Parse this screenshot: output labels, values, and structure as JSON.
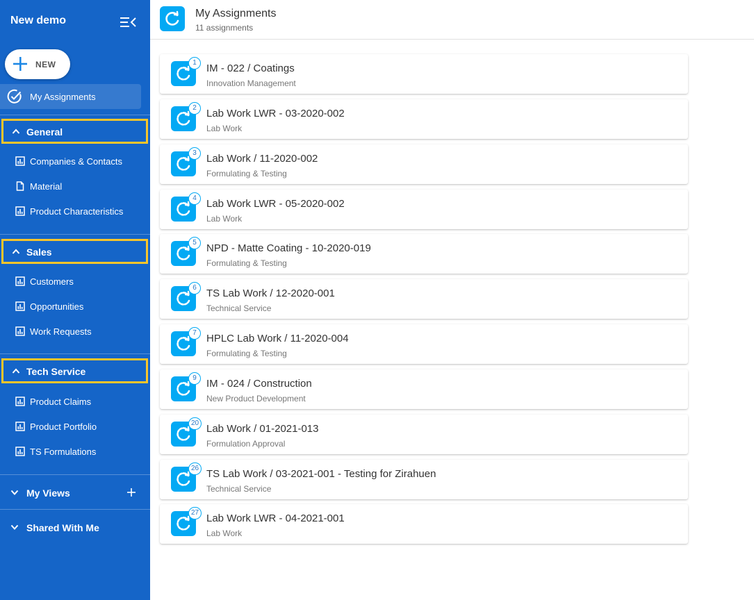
{
  "sidebar": {
    "app_title": "New demo",
    "new_button_label": "NEW",
    "my_assignments_label": "My Assignments",
    "sections": [
      {
        "label": "General",
        "items": [
          {
            "label": "Companies & Contacts",
            "icon": "chart-icon"
          },
          {
            "label": "Material",
            "icon": "document-icon"
          },
          {
            "label": "Product Characteristics",
            "icon": "chart-icon"
          }
        ]
      },
      {
        "label": "Sales",
        "items": [
          {
            "label": "Customers",
            "icon": "chart-icon"
          },
          {
            "label": "Opportunities",
            "icon": "chart-icon"
          },
          {
            "label": "Work Requests",
            "icon": "chart-icon"
          }
        ]
      },
      {
        "label": "Tech Service",
        "items": [
          {
            "label": "Product Claims",
            "icon": "chart-icon"
          },
          {
            "label": "Product Portfolio",
            "icon": "chart-icon"
          },
          {
            "label": "TS Formulations",
            "icon": "chart-icon"
          }
        ]
      }
    ],
    "my_views_label": "My Views",
    "shared_with_me_label": "Shared With Me",
    "highlight_color": "#f7c52b",
    "background_color": "#1565c8"
  },
  "header": {
    "title": "My Assignments",
    "subtitle": "11 assignments"
  },
  "assignments": [
    {
      "badge": "1",
      "title": "IM - 022 / Coatings",
      "subtitle": "Innovation Management"
    },
    {
      "badge": "2",
      "title": "Lab Work LWR - 03-2020-002",
      "subtitle": "Lab Work"
    },
    {
      "badge": "3",
      "title": "Lab Work / 11-2020-002",
      "subtitle": "Formulating & Testing"
    },
    {
      "badge": "4",
      "title": "Lab Work LWR - 05-2020-002",
      "subtitle": "Lab Work"
    },
    {
      "badge": "5",
      "title": "NPD - Matte Coating - 10-2020-019",
      "subtitle": "Formulating & Testing"
    },
    {
      "badge": "6",
      "title": "TS Lab Work / 12-2020-001",
      "subtitle": "Technical Service"
    },
    {
      "badge": "7",
      "title": "HPLC Lab Work / 11-2020-004",
      "subtitle": "Formulating & Testing"
    },
    {
      "badge": "9",
      "title": "IM - 024 / Construction",
      "subtitle": "New Product Development"
    },
    {
      "badge": "20",
      "title": "Lab Work / 01-2021-013",
      "subtitle": "Formulation Approval"
    },
    {
      "badge": "26",
      "title": "TS Lab Work / 03-2021-001 - Testing for Zirahuen",
      "subtitle": "Technical Service"
    },
    {
      "badge": "27",
      "title": "Lab Work LWR - 04-2021-001",
      "subtitle": "Lab Work"
    }
  ],
  "accent_color": "#03a9f4"
}
